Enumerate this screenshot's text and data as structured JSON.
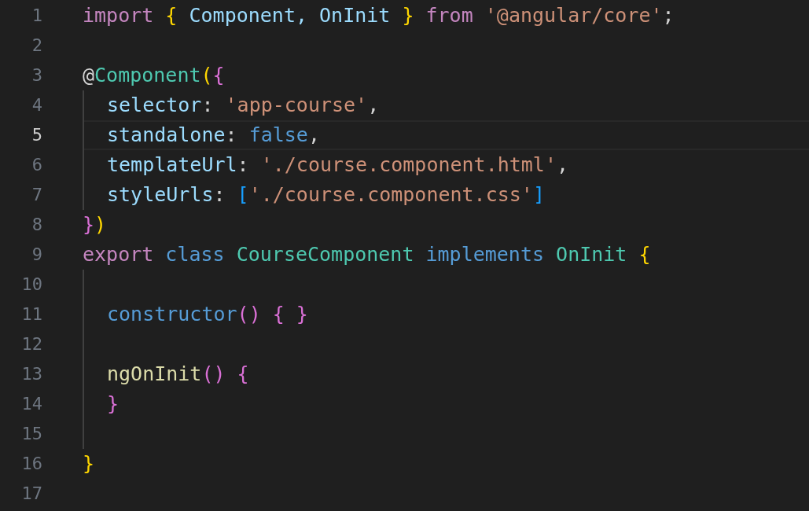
{
  "editor": {
    "lines": [
      {
        "number": "1",
        "current": false,
        "indent_guide": false,
        "tokens": [
          {
            "kind": "keyword",
            "text": "import "
          },
          {
            "kind": "brace1",
            "text": "{"
          },
          {
            "kind": "variable",
            "text": " Component, OnInit "
          },
          {
            "kind": "brace1",
            "text": "} "
          },
          {
            "kind": "keyword",
            "text": "from "
          },
          {
            "kind": "string",
            "text": "'@angular/core'"
          },
          {
            "kind": "plain",
            "text": ";"
          }
        ]
      },
      {
        "number": "2",
        "current": false,
        "indent_guide": false
      },
      {
        "number": "3",
        "current": false,
        "indent_guide": false,
        "tokens": [
          {
            "kind": "plain",
            "text": "@"
          },
          {
            "kind": "type",
            "text": "Component"
          },
          {
            "kind": "brace1",
            "text": "("
          },
          {
            "kind": "brace2",
            "text": "{"
          }
        ]
      },
      {
        "number": "4",
        "current": false,
        "indent_guide": true,
        "tokens": [
          {
            "kind": "variable",
            "text": "selector"
          },
          {
            "kind": "plain",
            "text": ": "
          },
          {
            "kind": "string",
            "text": "'app-course'"
          },
          {
            "kind": "plain",
            "text": ","
          }
        ]
      },
      {
        "number": "5",
        "current": true,
        "indent_guide": true,
        "tokens": [
          {
            "kind": "variable",
            "text": "standalone"
          },
          {
            "kind": "plain",
            "text": ": "
          },
          {
            "kind": "constant",
            "text": "false"
          },
          {
            "kind": "plain",
            "text": ","
          }
        ]
      },
      {
        "number": "6",
        "current": false,
        "indent_guide": true,
        "tokens": [
          {
            "kind": "variable",
            "text": "templateUrl"
          },
          {
            "kind": "plain",
            "text": ": "
          },
          {
            "kind": "string",
            "text": "'./course.component.html'"
          },
          {
            "kind": "plain",
            "text": ","
          }
        ]
      },
      {
        "number": "7",
        "current": false,
        "indent_guide": true,
        "tokens": [
          {
            "kind": "variable",
            "text": "styleUrls"
          },
          {
            "kind": "plain",
            "text": ": "
          },
          {
            "kind": "brace3",
            "text": "["
          },
          {
            "kind": "string",
            "text": "'./course.component.css'"
          },
          {
            "kind": "brace3",
            "text": "]"
          }
        ]
      },
      {
        "number": "8",
        "current": false,
        "indent_guide": false,
        "tokens": [
          {
            "kind": "brace2",
            "text": "}"
          },
          {
            "kind": "brace1",
            "text": ")"
          }
        ]
      },
      {
        "number": "9",
        "current": false,
        "indent_guide": false,
        "tokens": [
          {
            "kind": "keyword",
            "text": "export "
          },
          {
            "kind": "constant",
            "text": "class "
          },
          {
            "kind": "type",
            "text": "CourseComponent "
          },
          {
            "kind": "constant",
            "text": "implements "
          },
          {
            "kind": "type",
            "text": "OnInit "
          },
          {
            "kind": "brace1",
            "text": "{"
          }
        ]
      },
      {
        "number": "10",
        "current": false,
        "indent_guide": true
      },
      {
        "number": "11",
        "current": false,
        "indent_guide": true,
        "tokens": [
          {
            "kind": "constant",
            "text": "constructor"
          },
          {
            "kind": "brace2",
            "text": "() "
          },
          {
            "kind": "brace2",
            "text": "{ }"
          }
        ]
      },
      {
        "number": "12",
        "current": false,
        "indent_guide": true
      },
      {
        "number": "13",
        "current": false,
        "indent_guide": true,
        "tokens": [
          {
            "kind": "function",
            "text": "ngOnInit"
          },
          {
            "kind": "brace2",
            "text": "() "
          },
          {
            "kind": "brace2",
            "text": "{"
          }
        ]
      },
      {
        "number": "14",
        "current": false,
        "indent_guide": true,
        "tokens": [
          {
            "kind": "brace2",
            "text": "}"
          }
        ]
      },
      {
        "number": "15",
        "current": false,
        "indent_guide": true
      },
      {
        "number": "16",
        "current": false,
        "indent_guide": false,
        "tokens": [
          {
            "kind": "brace1",
            "text": "}"
          }
        ]
      },
      {
        "number": "17",
        "current": false,
        "indent_guide": false
      }
    ]
  }
}
